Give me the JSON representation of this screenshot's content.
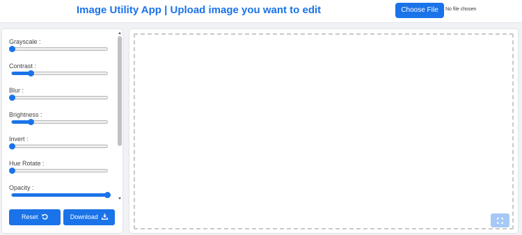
{
  "header": {
    "title": "Image Utility App | Upload image you want to edit",
    "file_button_label": "Choose File",
    "file_status": "No file chosen"
  },
  "controls": [
    {
      "label": "Grayscale :",
      "value_percent": 0
    },
    {
      "label": "Contrast :",
      "value_percent": 20
    },
    {
      "label": "Blur :",
      "value_percent": 0
    },
    {
      "label": "Brightness :",
      "value_percent": 20
    },
    {
      "label": "Invert :",
      "value_percent": 0
    },
    {
      "label": "Hue Rotate :",
      "value_percent": 0
    },
    {
      "label": "Opacity :",
      "value_percent": 100
    }
  ],
  "actions": {
    "reset_label": "Reset",
    "reset_icon": "undo-icon",
    "download_label": "Download",
    "download_icon": "download-icon"
  },
  "preview": {
    "fullscreen_icon": "fullscreen-icon"
  },
  "colors": {
    "accent": "#1a73e8",
    "background": "#f1f2f6",
    "dropzone_border": "#c9c9c9"
  }
}
